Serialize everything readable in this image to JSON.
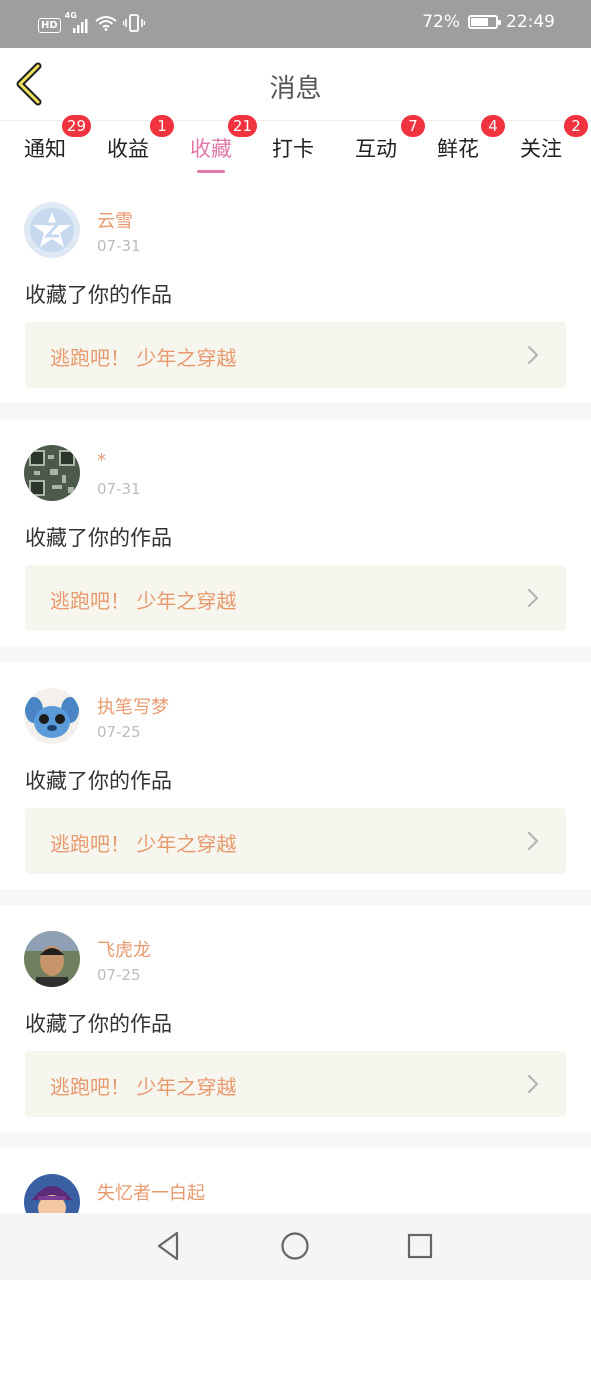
{
  "status_bar": {
    "hd": "HD",
    "network": "4G",
    "battery_percent": "72%",
    "battery_level": 0.72,
    "time": "22:49"
  },
  "header": {
    "title": "消息",
    "back_icon": "chevron-left-icon"
  },
  "tabs": [
    {
      "label": "通知",
      "badge": "29",
      "active": false
    },
    {
      "label": "收益",
      "badge": "1",
      "active": false
    },
    {
      "label": "收藏",
      "badge": "21",
      "active": true
    },
    {
      "label": "打卡",
      "badge": "",
      "active": false
    },
    {
      "label": "互动",
      "badge": "7",
      "active": false
    },
    {
      "label": "鲜花",
      "badge": "4",
      "active": false
    },
    {
      "label": "关注",
      "badge": "2",
      "active": false
    }
  ],
  "messages": [
    {
      "name": "云雪",
      "date": "07-31",
      "text": "收藏了你的作品",
      "work": "逃跑吧！ 少年之穿越"
    },
    {
      "name": "*",
      "date": "07-31",
      "text": "收藏了你的作品",
      "work": "逃跑吧！ 少年之穿越"
    },
    {
      "name": "执笔写梦",
      "date": "07-25",
      "text": "收藏了你的作品",
      "work": "逃跑吧！ 少年之穿越"
    },
    {
      "name": "飞虎龙",
      "date": "07-25",
      "text": "收藏了你的作品",
      "work": "逃跑吧！ 少年之穿越"
    },
    {
      "name": "失忆者一白起"
    }
  ],
  "colors": {
    "accent_pink": "#e07aa8",
    "name_orange": "#e89a6e",
    "badge_red": "#f0333f",
    "card_bg": "#f6f6ee"
  },
  "navbar": {
    "icons": [
      "back-triangle-icon",
      "home-circle-icon",
      "recents-square-icon"
    ]
  }
}
